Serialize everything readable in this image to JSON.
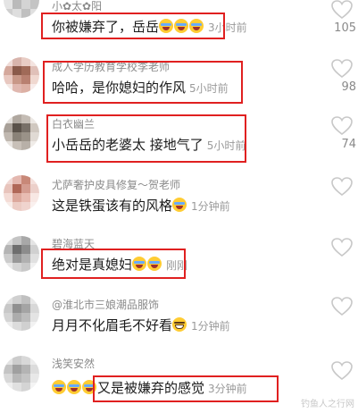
{
  "comments": [
    {
      "username": "小✿太✿阳",
      "content": "你被嫌弃了，岳岳",
      "emoji_count": 3,
      "emoji_prefix": 0,
      "time": "3小时前",
      "likes": "105"
    },
    {
      "username": "成人学历教育学校李老师",
      "content": "哈哈，是你媳妇的作风",
      "emoji_count": 0,
      "emoji_prefix": 0,
      "time": "5小时前",
      "likes": "98"
    },
    {
      "username": "白衣幽兰",
      "content": "小岳岳的老婆太 接地气了",
      "emoji_count": 0,
      "emoji_prefix": 0,
      "time": "5小时前",
      "likes": "74"
    },
    {
      "username": "尤萨奢护皮具修复～贺老师",
      "content": "这是铁蛋该有的风格",
      "emoji_count": 1,
      "emoji_prefix": 0,
      "time": "1分钟前",
      "likes": ""
    },
    {
      "username": "碧海蓝天",
      "content": "绝对是真媳妇",
      "emoji_count": 2,
      "emoji_prefix": 0,
      "time": "刚刚",
      "likes": ""
    },
    {
      "username": "@淮北市三娘潮品服饰",
      "content": "月月不化眉毛不好看",
      "emoji_count": 1,
      "emoji_prefix": 0,
      "time": "1分钟前",
      "likes": ""
    },
    {
      "username": "浅笑安然",
      "content": "又是被嫌弃的感觉",
      "emoji_count": 0,
      "emoji_prefix": 3,
      "time": "3分钟前",
      "likes": ""
    }
  ],
  "icons": {
    "like": "heart-outline-icon",
    "emoji": "laughing-tears-emoji-icon"
  },
  "colors": {
    "highlight": "#e02020",
    "username": "#8a8a8a",
    "content": "#1a1a1a",
    "time": "#9a9a9a",
    "heart": "#c8c8c8"
  },
  "watermark": "钓鱼人之行网"
}
